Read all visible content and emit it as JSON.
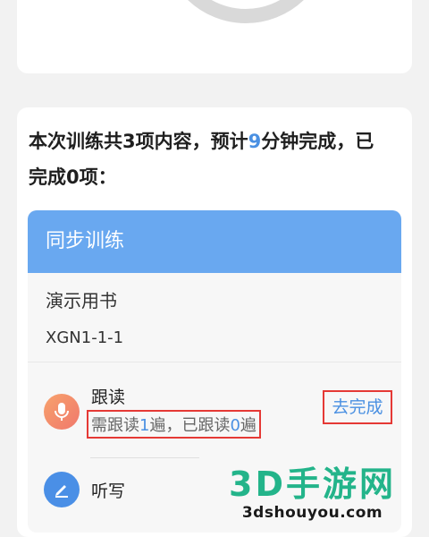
{
  "summary": {
    "prefix": "本次训练共3项内容，预计",
    "minutes": "9",
    "suffix": "分钟完成，已完成0项："
  },
  "section": {
    "title": "同步训练",
    "book_name": "演示用书",
    "book_code": "XGN1-1-1"
  },
  "tasks": [
    {
      "title": "跟读",
      "desc_prefix": "需跟读",
      "required": "1",
      "desc_middle": "遍，已跟读",
      "done": "0",
      "desc_suffix": "遍",
      "action": "去完成",
      "icon": "microphone-icon"
    },
    {
      "title": "听写",
      "icon": "pen-icon"
    }
  ],
  "watermark": {
    "logo": "3D手游网",
    "url": "3dshouyou.com"
  },
  "colors": {
    "accent": "#4a90e2",
    "header": "#69a8f0",
    "annotation": "#e53935"
  }
}
